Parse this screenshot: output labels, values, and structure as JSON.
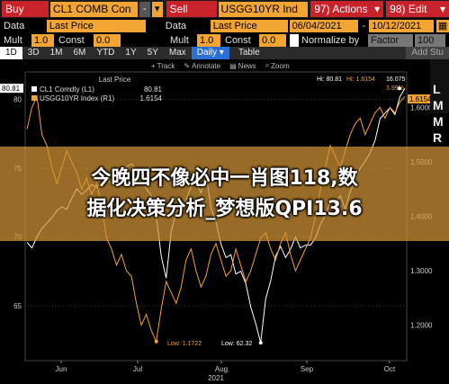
{
  "toolbar": {
    "buy_label": "Buy",
    "security1": "CL1 COMB Con",
    "minus": "-",
    "sell_label": "Sell",
    "security2": "USGG10YR Ind",
    "actions_label": "97) Actions",
    "actions_arrow": "▾",
    "edit_label": "98) Edit",
    "edit_arrow": "▾"
  },
  "row2": {
    "data_label": "Data",
    "data_value": "Last Price",
    "data2_label": "Data",
    "data2_value": "Last Price",
    "start_date": "06/04/2021",
    "dash": "-",
    "end_date": "10/12/2021"
  },
  "row3": {
    "mult_label": "Mult",
    "mult_value": "1.0",
    "const_label": "Const",
    "const_value": "0.0",
    "mult2_label": "Mult",
    "mult2_value": "1.0",
    "const2_label": "Const",
    "const2_value": "0.0",
    "normalize_label": "Normalize by",
    "normalize_value": "Factor",
    "extra_value": "100"
  },
  "tabs": {
    "items": [
      "1D",
      "3D",
      "1M",
      "6M",
      "YTD",
      "1Y",
      "5Y",
      "Max"
    ],
    "daily": "Daily ▾",
    "table": "Table",
    "add_study": "Add Stu"
  },
  "tools": {
    "track": "Track",
    "annotate": "Annotate",
    "news": "News",
    "zoom": "Zoom"
  },
  "legend": {
    "header": "Last Price",
    "series": [
      {
        "name": "CL1 Comdty (L1)",
        "value": "80.81",
        "color": "#ffffff"
      },
      {
        "name": "USGG10YR Index (R1)",
        "value": "1.6154",
        "color": "#f0a030"
      }
    ]
  },
  "chart_data": {
    "type": "line",
    "x_labels": [
      "Jun",
      "Jul",
      "Aug",
      "Sep",
      "Oct"
    ],
    "x_sublabel": "2021",
    "left_axis": {
      "ticks": [
        65,
        70,
        75,
        80
      ],
      "flags": [
        "80.81"
      ]
    },
    "right_axis": {
      "ticks": [
        1.2,
        1.3,
        1.4,
        1.5,
        1.6
      ],
      "tick_labels": [
        "1.2000",
        "1.3000",
        "1.4000",
        "1.5000",
        "1.6000"
      ],
      "flags": [
        "1.6154"
      ]
    },
    "annotations": {
      "hi_left": "Hi: 80.81",
      "hi_right": "Hi: 1.6154",
      "hi_right2": "16.075",
      "hi_pct": "3.99%",
      "low_right": "Low: 1.1722",
      "low_left": "Low: 62.32"
    },
    "series": [
      {
        "name": "CL1 Comdty (L1)",
        "color": "#ffffff",
        "points": [
          69.6,
          69.2,
          70.0,
          70.6,
          71.0,
          71.4,
          71.9,
          72.2,
          72.0,
          72.8,
          73.5,
          73.1,
          73.4,
          73.8,
          73.6,
          74.0,
          74.2,
          73.9,
          74.1,
          74.4,
          75.1,
          75.3,
          74.9,
          74.5,
          73.5,
          73.0,
          71.5,
          68.6,
          67.0,
          70.4,
          71.8,
          72.2,
          72.7,
          73.7,
          73.9,
          73.2,
          74.6,
          72.1,
          71.1,
          69.5,
          68.5,
          68.7,
          67.3,
          67.5,
          66.6,
          64.9,
          63.7,
          62.3,
          65.5,
          66.8,
          68.6,
          69.3,
          68.5,
          69.1,
          70.0,
          69.2,
          69.4,
          69.4,
          69.9,
          70.9,
          71.6,
          72.5,
          72.4,
          73.0,
          72.0,
          73.3,
          74.1,
          75.0,
          75.5,
          76.1,
          77.0,
          78.6,
          79.0,
          79.4,
          78.9,
          80.2,
          80.8
        ]
      },
      {
        "name": "USGG10YR Index (R1)",
        "color": "#f0a030",
        "points": [
          1.56,
          1.6,
          1.62,
          1.55,
          1.53,
          1.49,
          1.46,
          1.49,
          1.52,
          1.5,
          1.48,
          1.45,
          1.47,
          1.44,
          1.46,
          1.42,
          1.36,
          1.34,
          1.31,
          1.33,
          1.3,
          1.29,
          1.24,
          1.2,
          1.22,
          1.19,
          1.17,
          1.23,
          1.28,
          1.26,
          1.24,
          1.27,
          1.32,
          1.34,
          1.3,
          1.27,
          1.29,
          1.33,
          1.35,
          1.32,
          1.29,
          1.3,
          1.34,
          1.31,
          1.28,
          1.3,
          1.33,
          1.36,
          1.37,
          1.34,
          1.32,
          1.35,
          1.37,
          1.33,
          1.3,
          1.32,
          1.34,
          1.36,
          1.4,
          1.45,
          1.49,
          1.53,
          1.51,
          1.49,
          1.52,
          1.55,
          1.57,
          1.58,
          1.55,
          1.57,
          1.59,
          1.6,
          1.58,
          1.6,
          1.59,
          1.61,
          1.62
        ]
      }
    ]
  },
  "banner": {
    "line1": "今晚四不像必中一肖图118,数",
    "line2": "据化决策分析_梦想版QPI13.6"
  },
  "right_stub": {
    "letters": [
      "L",
      "M",
      "M",
      "R"
    ]
  }
}
